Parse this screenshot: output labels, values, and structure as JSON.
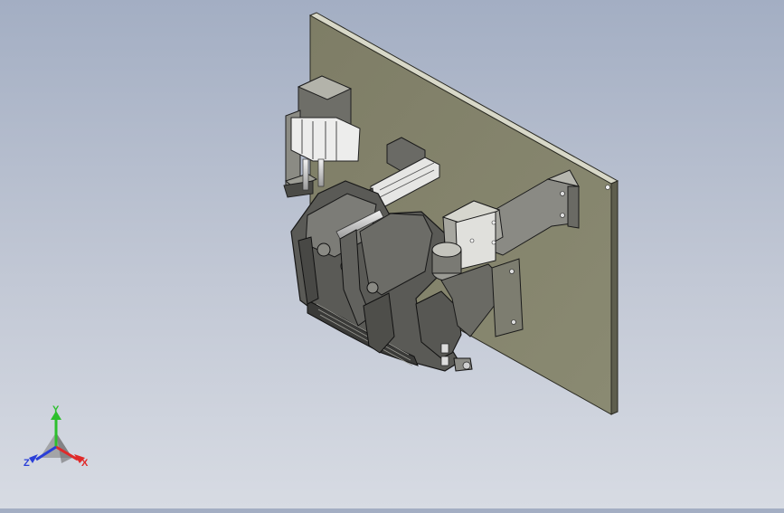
{
  "viewport": {
    "background_top": "#a3aec3",
    "background_bottom": "#d7dbe3",
    "model_description_visible": false
  },
  "triad": {
    "x_label": "X",
    "y_label": "Y",
    "z_label": "Z",
    "x_color": "#e02a2a",
    "y_color": "#2dbf2d",
    "z_color": "#2a3fd8"
  }
}
